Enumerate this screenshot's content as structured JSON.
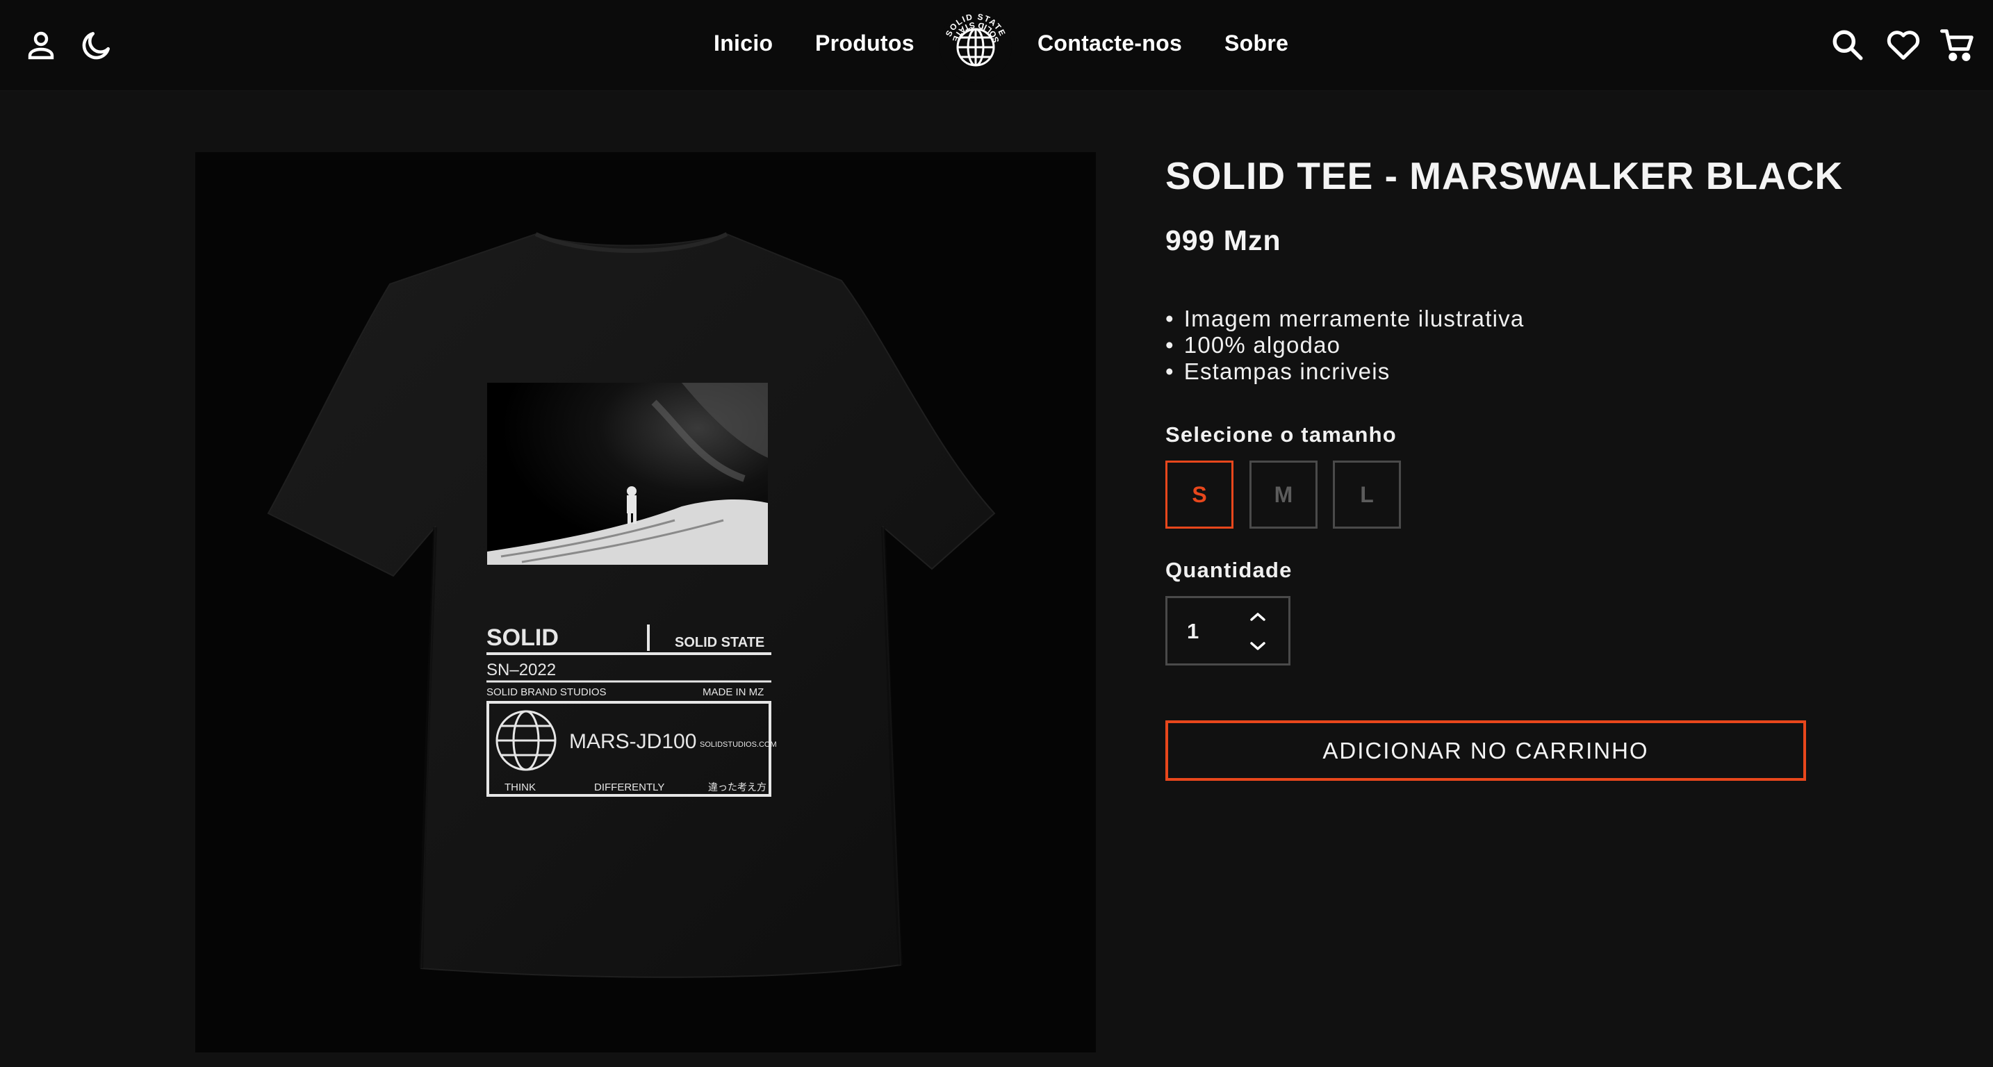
{
  "header": {
    "nav": [
      {
        "label": "Inicio"
      },
      {
        "label": "Produtos"
      },
      {
        "label": "Contacte-nos"
      },
      {
        "label": "Sobre"
      }
    ],
    "logo_text": "SOLID STATE",
    "icons": {
      "left": [
        "user-icon",
        "moon-icon"
      ],
      "right": [
        "search-icon",
        "heart-icon",
        "cart-icon"
      ]
    }
  },
  "product": {
    "title": "SOLID TEE - MARSWALKER BLACK",
    "price": "999 Mzn",
    "features": [
      "Imagem merramente ilustrativa",
      "100% algodao",
      "Estampas incriveis"
    ],
    "size_label": "Selecione o tamanho",
    "sizes": [
      {
        "label": "S",
        "selected": true
      },
      {
        "label": "M",
        "selected": false
      },
      {
        "label": "L",
        "selected": false
      }
    ],
    "quantity_label": "Quantidade",
    "quantity": "1",
    "add_to_cart": "ADICIONAR NO CARRINHO",
    "print": {
      "brand": "SOLID",
      "brand_right": "SOLID STATE",
      "code": "SN–2022",
      "studio": "SOLID BRAND STUDIOS",
      "origin": "MADE IN MZ",
      "model": "MARS-JD100",
      "site": "SOLIDSTUDIOS.COM",
      "foot_left": "THINK",
      "foot_mid": "DIFFERENTLY",
      "foot_right": "違った考え方"
    }
  },
  "colors": {
    "accent": "#e8471c",
    "background": "#111111",
    "header": "#0b0b0b"
  }
}
